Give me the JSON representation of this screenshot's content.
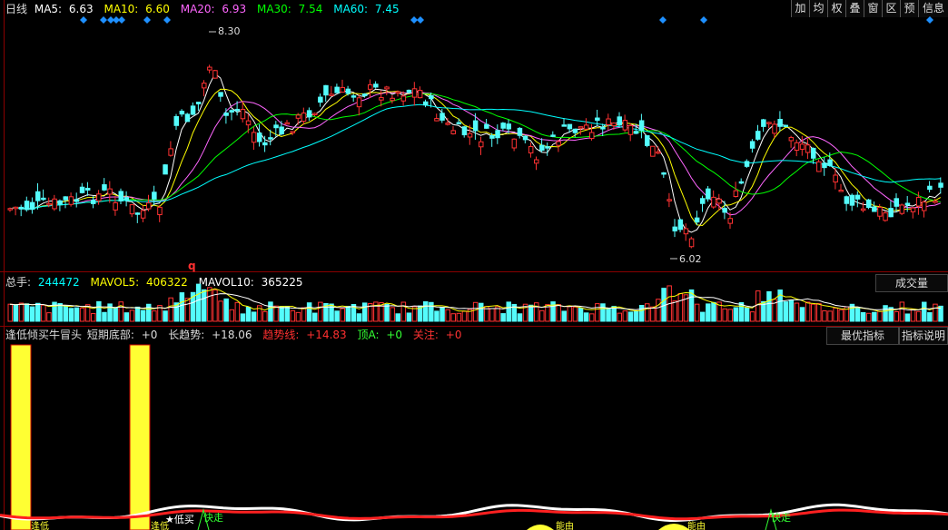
{
  "price_legend": {
    "period": "日线",
    "ma5_label": "MA5:",
    "ma5_value": "6.63",
    "ma5_color": "#ffffff",
    "ma10_label": "MA10:",
    "ma10_value": "6.60",
    "ma10_color": "#ffff00",
    "ma20_label": "MA20:",
    "ma20_value": "6.93",
    "ma20_color": "#ff66ff",
    "ma30_label": "MA30:",
    "ma30_value": "7.54",
    "ma30_color": "#00ff00",
    "ma60_label": "MA60:",
    "ma60_value": "7.45",
    "ma60_color": "#00ffff"
  },
  "toolbar": {
    "buttons": [
      "加",
      "均",
      "权",
      "叠",
      "窗",
      "区",
      "预",
      "信息"
    ]
  },
  "price_annotations": {
    "high": "8.30",
    "low": "6.02",
    "marker": "q"
  },
  "volume_legend": {
    "total_label": "总手:",
    "total_value": "244472",
    "mavol5_label": "MAVOL5:",
    "mavol5_value": "406322",
    "mavol10_label": "MAVOL10:",
    "mavol10_value": "365225",
    "button": "成交量"
  },
  "indicator_legend": {
    "name": "逢低倾买牛冒头",
    "short_bottom_label": "短期底部:",
    "short_bottom_value": "+0",
    "long_trend_label": "长趋势:",
    "long_trend_value": "+18.06",
    "trend_line_label": "趋势线:",
    "trend_line_value": "+14.83",
    "top_a_label": "顶A:",
    "top_a_value": "+0",
    "focus_label": "关注:",
    "focus_value": "+0",
    "best_button": "最优指标",
    "explain_button": "指标说明"
  },
  "indicator_signals": {
    "low_buy": "★低买",
    "fast_run_1": "快走",
    "fast_run_2": "快走",
    "tiny_label_1": "逢低",
    "tiny_label_2": "逢低",
    "tiny_label_3": "能由",
    "tiny_label_4": "能由"
  }
}
